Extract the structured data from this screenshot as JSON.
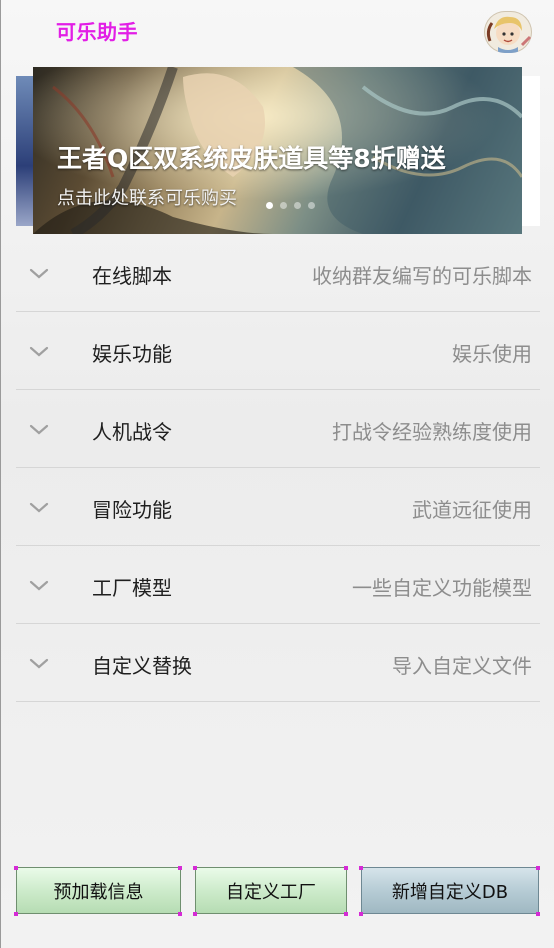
{
  "app": {
    "title": "可乐助手"
  },
  "banner": {
    "title": "王者Q区双系统皮肤道具等8折赠送",
    "subtitle": "点击此处联系可乐购买",
    "dots": 4,
    "active_dot": 0
  },
  "menu": {
    "items": [
      {
        "title": "在线脚本",
        "desc": "收纳群友编写的可乐脚本"
      },
      {
        "title": "娱乐功能",
        "desc": "娱乐使用"
      },
      {
        "title": "人机战令",
        "desc": "打战令经验熟练度使用"
      },
      {
        "title": "冒险功能",
        "desc": "武道远征使用"
      },
      {
        "title": "工厂模型",
        "desc": "一些自定义功能模型"
      },
      {
        "title": "自定义替换",
        "desc": "导入自定义文件"
      }
    ]
  },
  "buttons": {
    "preload": "预加载信息",
    "factory": "自定义工厂",
    "add_db": "新增自定义DB"
  },
  "colors": {
    "title_accent": "#e21ee6",
    "corner_marker": "#d52bd5"
  }
}
